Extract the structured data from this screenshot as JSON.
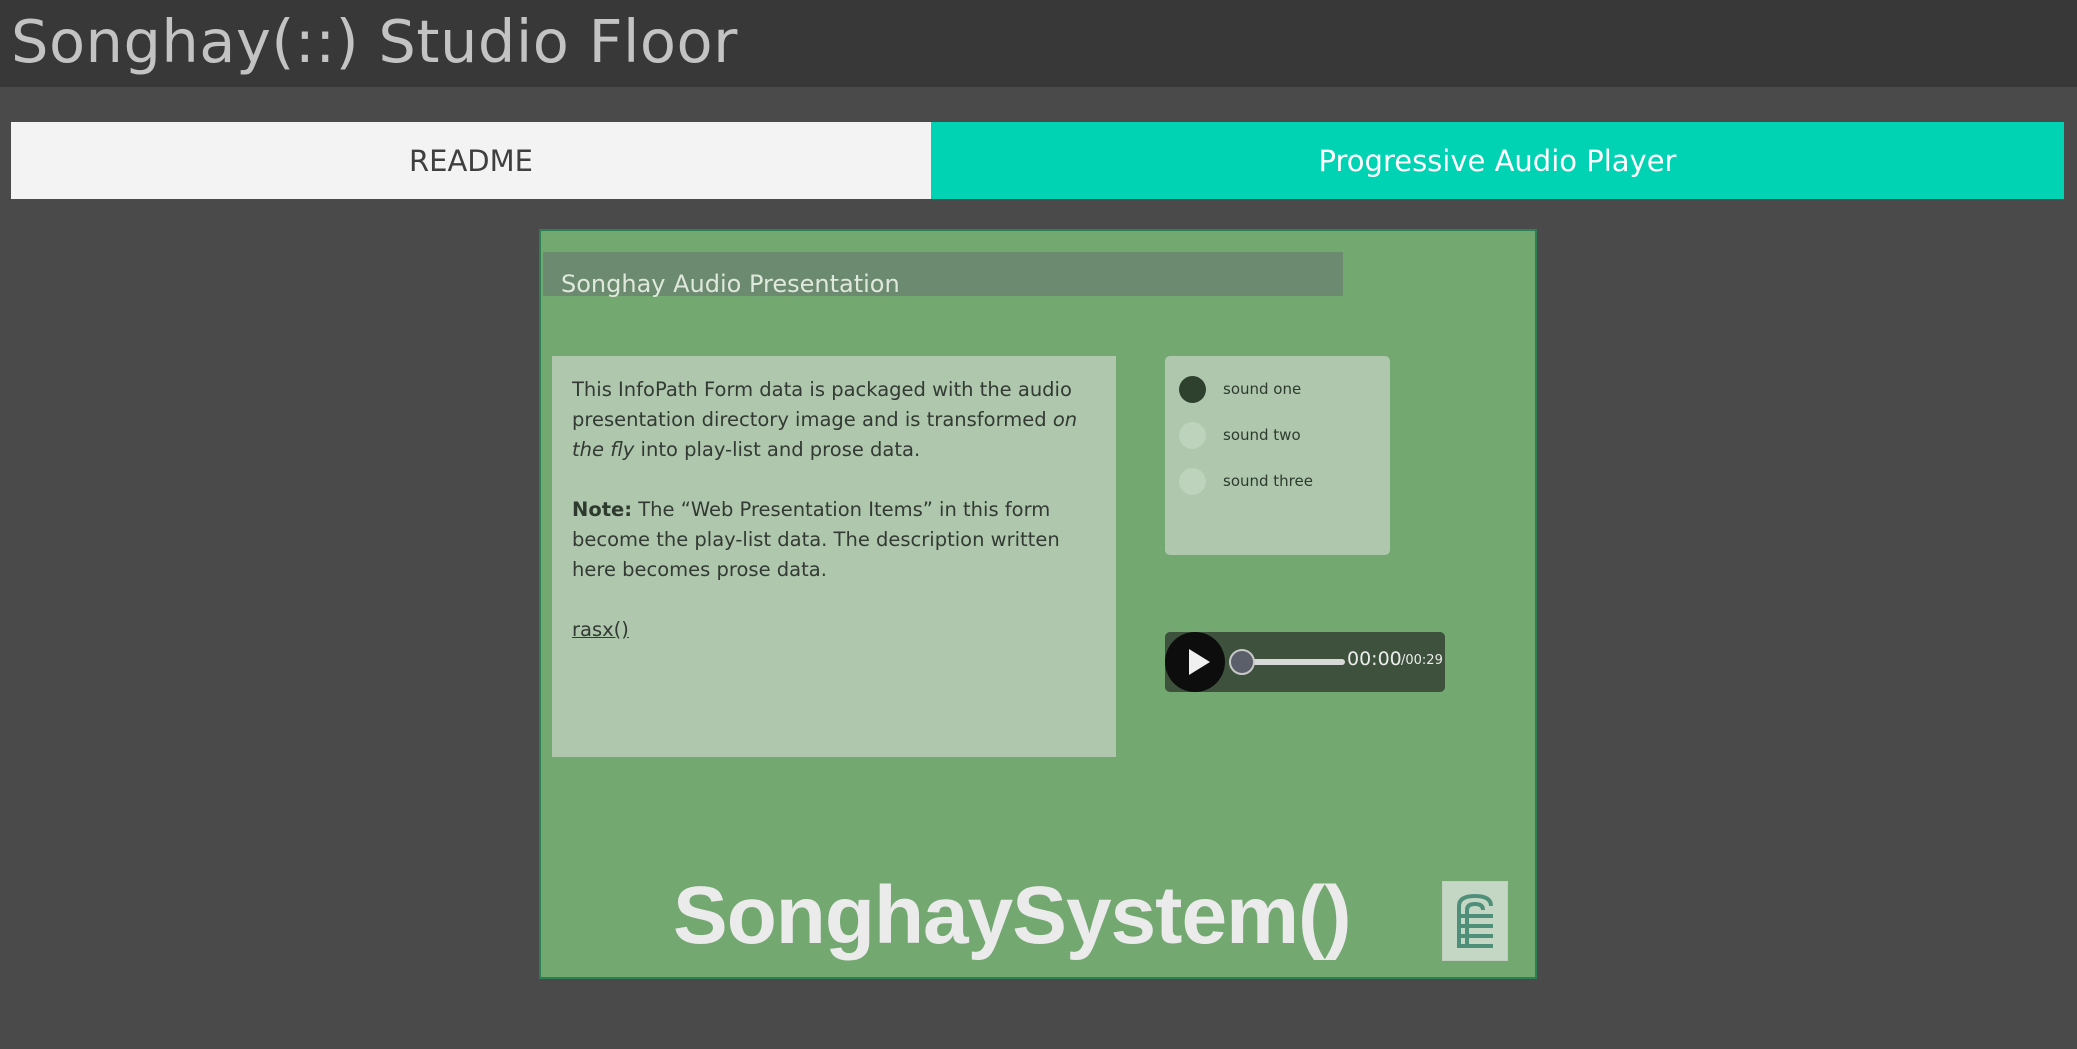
{
  "app": {
    "title": "Songhay(::) Studio Floor"
  },
  "tabs": [
    {
      "label": "README",
      "active": false
    },
    {
      "label": "Progressive Audio Player",
      "active": true
    }
  ],
  "presentation": {
    "title": "Songhay Audio Presentation",
    "prose": {
      "p1_a": "This InfoPath Form data is packaged with the audio presentation directory image and is transformed ",
      "p1_em": "on the fly",
      "p1_b": " into play-list and prose data.",
      "p2_strong": "Note:",
      "p2_text": " The “Web Presentation Items” in this form become the play-list data. The description written here becomes prose data.",
      "link": "rasx()"
    },
    "playlist": [
      {
        "label": "sound one",
        "selected": true
      },
      {
        "label": "sound two",
        "selected": false
      },
      {
        "label": "sound three",
        "selected": false
      }
    ],
    "player": {
      "current_time": "00:00",
      "total_time": "/00:29",
      "progress": 0
    },
    "brand": {
      "wordmark": "SonghaySystem()"
    }
  },
  "colors": {
    "header_bg": "#383838",
    "page_bg": "#4a4a4a",
    "active_tab": "#00d2b4",
    "presentation_bg": "#73a871",
    "panel_bg": "#aec7ad"
  },
  "icons": {
    "play": "play-icon",
    "logo": "songhay-logo-icon"
  }
}
